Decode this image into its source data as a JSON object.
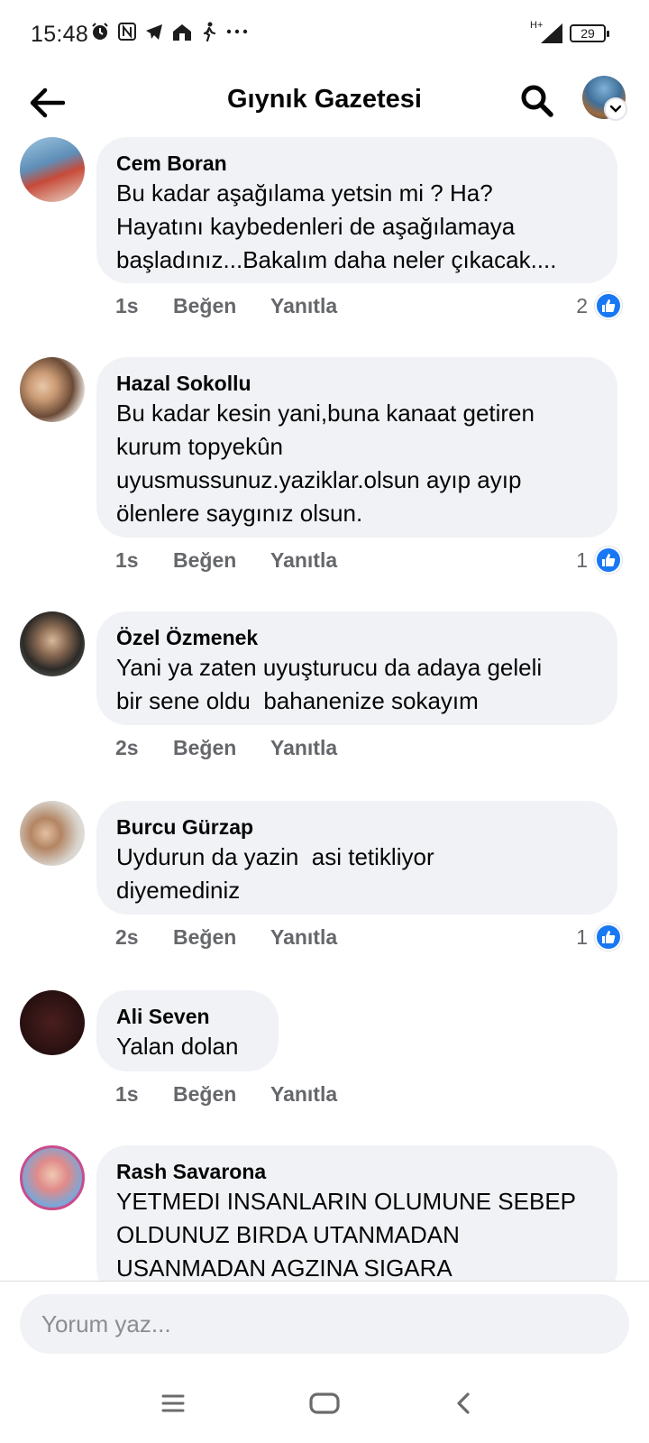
{
  "status_bar": {
    "time": "15:48",
    "network": "H+",
    "battery": "29"
  },
  "header": {
    "title": "Gıynık Gazetesi"
  },
  "comments": [
    {
      "author": "Cem Boran",
      "text": "Bu kadar aşağılama yetsin mi ? Ha?\nHayatını kaybedenleri de aşağılamaya\nbaşladınız...Bakalım daha neler çıkacak....",
      "time": "1s",
      "like_label": "Beğen",
      "reply_label": "Yanıtla",
      "reaction_count": "2"
    },
    {
      "author": "Hazal Sokollu",
      "text": "Bu kadar kesin yani,buna kanaat getiren\nkurum topyekûn\nuyusmussunuz.yaziklar.olsun ayıp ayıp\nölenlere saygınız olsun.",
      "time": "1s",
      "like_label": "Beğen",
      "reply_label": "Yanıtla",
      "reaction_count": "1"
    },
    {
      "author": "Özel Özmenek",
      "text": "Yani ya zaten uyuşturucu da adaya geleli\nbir sene oldu  bahanenize sokayım",
      "time": "2s",
      "like_label": "Beğen",
      "reply_label": "Yanıtla",
      "reaction_count": ""
    },
    {
      "author": "Burcu Gürzap",
      "text": "Uydurun da yazin  asi tetikliyor\ndiyemediniz",
      "time": "2s",
      "like_label": "Beğen",
      "reply_label": "Yanıtla",
      "reaction_count": "1"
    },
    {
      "author": "Ali Seven",
      "text": "Yalan dolan",
      "time": "1s",
      "like_label": "Beğen",
      "reply_label": "Yanıtla",
      "reaction_count": ""
    },
    {
      "author": "Rash Savarona",
      "text": "YETMEDI INSANLARIN OLUMUNE SEBEP\nOLDUNUZ BIRDA UTANMADAN\nUSANMADAN AGZINA SIGARA",
      "time": "",
      "like_label": "",
      "reply_label": "",
      "reaction_count": ""
    }
  ],
  "composer": {
    "placeholder": "Yorum yaz..."
  },
  "colors": {
    "accent": "#1877f2",
    "bubble": "#f0f2f5",
    "meta_text": "#65676b"
  },
  "icons": {
    "back": "arrow-left-icon",
    "search": "search-icon",
    "like_reaction": "thumbs-up-icon",
    "nav_menu": "menu-icon",
    "nav_home": "home-icon",
    "nav_back": "chevron-left-icon"
  }
}
